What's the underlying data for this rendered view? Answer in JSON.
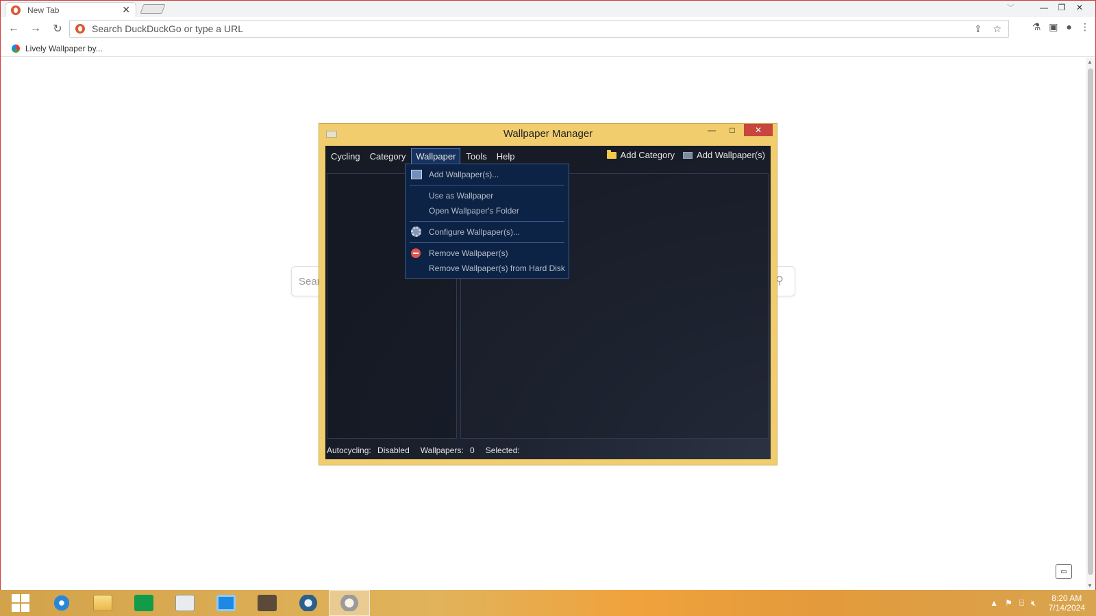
{
  "browser": {
    "tab_title": "New Tab",
    "tab_close": "✕",
    "omnibox_placeholder": "Search DuckDuckGo or type a URL",
    "bookmark_label": "Lively Wallpaper by...",
    "search_placeholder": "Sear",
    "icons": [
      "back-icon",
      "forward-icon",
      "reload-icon",
      "share-icon",
      "star-icon",
      "extensions-icon",
      "sidepanel-icon",
      "profile-icon",
      "menu-icon"
    ]
  },
  "wallpaper_manager": {
    "title": "Wallpaper Manager",
    "menu": [
      "Cycling",
      "Category",
      "Wallpaper",
      "Tools",
      "Help"
    ],
    "active_menu": "Wallpaper",
    "add_category": "Add Category",
    "add_wallpapers": "Add Wallpaper(s)",
    "dropdown": {
      "add": "Add Wallpaper(s)...",
      "use_as": "Use as Wallpaper",
      "open_folder": "Open Wallpaper's Folder",
      "configure": "Configure Wallpaper(s)...",
      "remove": "Remove Wallpaper(s)",
      "remove_disk": "Remove Wallpaper(s) from Hard Disk"
    },
    "status": {
      "autocycling_label": "Autocycling:",
      "autocycling_value": "Disabled",
      "wallpapers_label": "Wallpapers:",
      "wallpapers_value": "0",
      "selected_label": "Selected:"
    }
  },
  "taskbar": {
    "apps": [
      "start",
      "internet-explorer",
      "file-explorer",
      "store",
      "media-player",
      "virtualbox",
      "webcam",
      "steam",
      "wallpaper-manager"
    ],
    "time": "8:20 AM",
    "date": "7/14/2024"
  }
}
